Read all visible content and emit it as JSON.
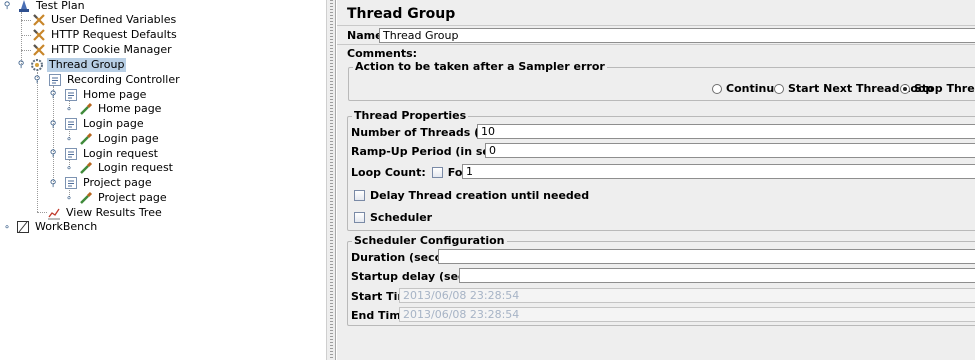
{
  "tree": {
    "items": [
      {
        "label": "Test Plan"
      },
      {
        "label": "User Defined Variables"
      },
      {
        "label": "HTTP Request Defaults"
      },
      {
        "label": "HTTP Cookie Manager"
      },
      {
        "label": "Thread Group"
      },
      {
        "label": "Recording Controller"
      },
      {
        "label": "Home page"
      },
      {
        "label": "Home page"
      },
      {
        "label": "Login page"
      },
      {
        "label": "Login page"
      },
      {
        "label": "Login request"
      },
      {
        "label": "Login request"
      },
      {
        "label": "Project page"
      },
      {
        "label": "Project page"
      },
      {
        "label": "View Results Tree"
      },
      {
        "label": "WorkBench"
      }
    ]
  },
  "panel": {
    "title": "Thread Group",
    "name_label": "Name:",
    "name_value": "Thread Group",
    "comments_label": "Comments:",
    "sampler_error": {
      "title": "Action to be taken after a Sampler error",
      "options": [
        "Continue",
        "Start Next Thread Loop",
        "Stop Thread"
      ],
      "selected": "Stop Thread"
    },
    "thread_props": {
      "title": "Thread Properties",
      "threads_label": "Number of Threads (users):",
      "threads_value": "10",
      "rampup_label": "Ramp-Up Period (in seconds):",
      "rampup_value": "0",
      "loop_label": "Loop Count:",
      "forever_label": "Forever",
      "loop_value": "1",
      "delay_label": "Delay Thread creation until needed",
      "scheduler_label": "Scheduler"
    },
    "scheduler_config": {
      "title": "Scheduler Configuration",
      "duration_label": "Duration (seconds)",
      "startup_label": "Startup delay (seconds)",
      "start_label": "Start Time",
      "start_value": "2013/06/08 23:28:54",
      "end_label": "End Time",
      "end_value": "2013/06/08 23:28:54"
    }
  }
}
